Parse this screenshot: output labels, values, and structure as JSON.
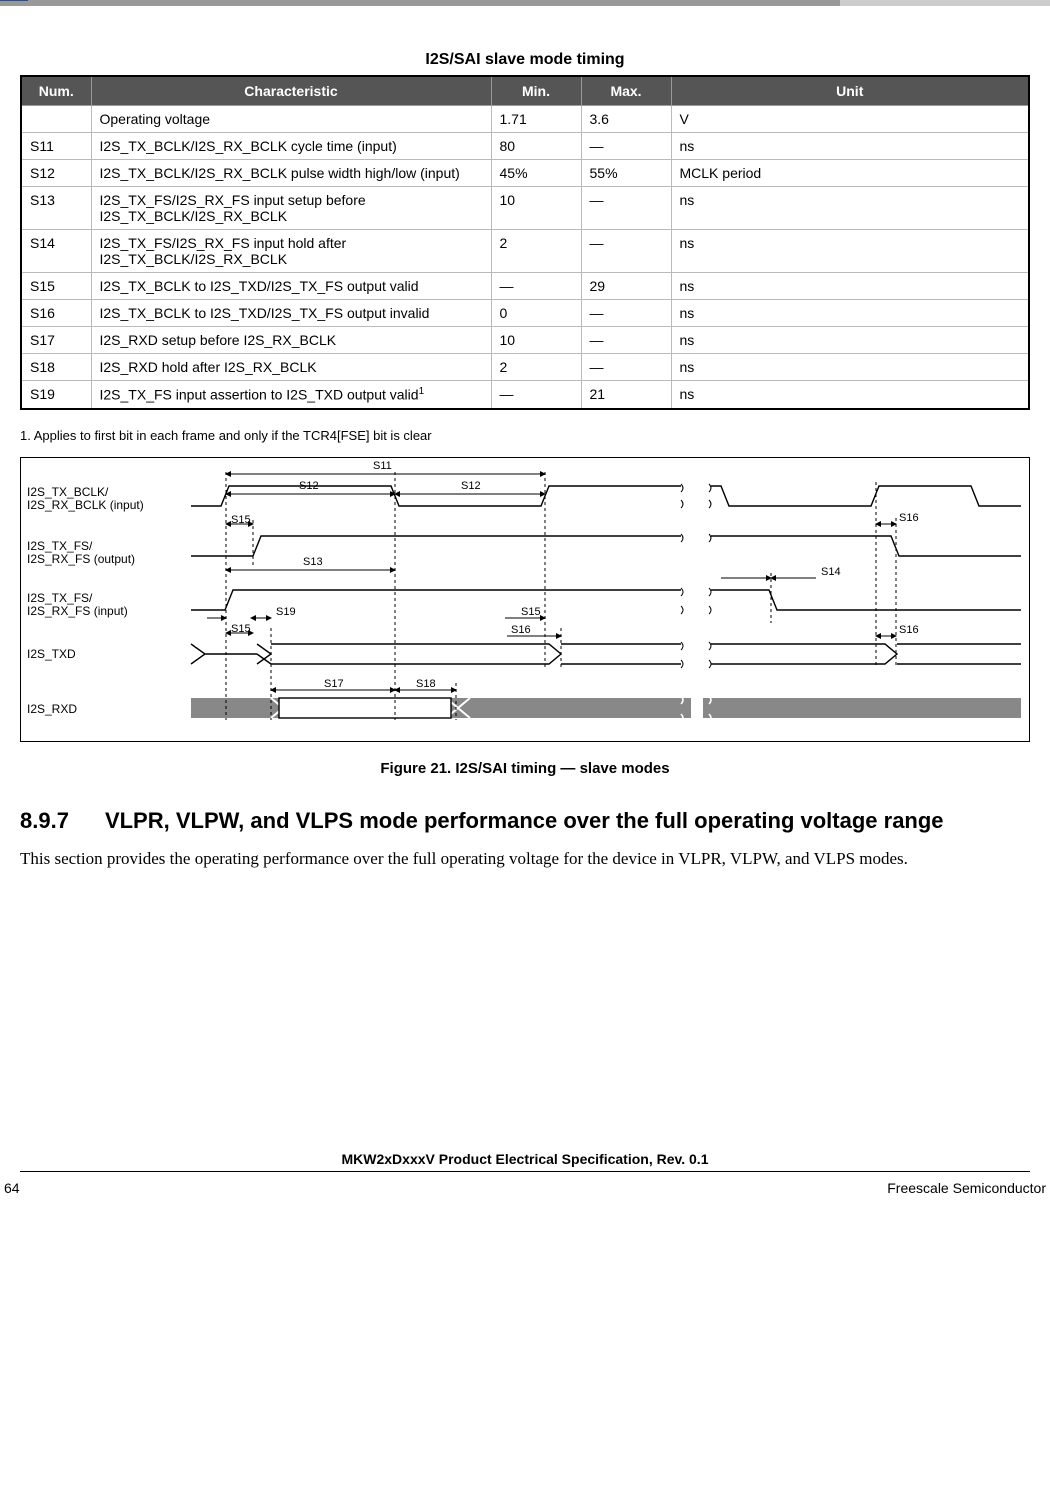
{
  "table_title": "I2S/SAI slave mode timing",
  "columns": {
    "num": "Num.",
    "char": "Characteristic",
    "min": "Min.",
    "max": "Max.",
    "unit": "Unit"
  },
  "rows": [
    {
      "num": "",
      "char": "Operating voltage",
      "min": "1.71",
      "max": "3.6",
      "unit": "V"
    },
    {
      "num": "S11",
      "char": "I2S_TX_BCLK/I2S_RX_BCLK cycle time (input)",
      "min": "80",
      "max": "—",
      "unit": "ns"
    },
    {
      "num": "S12",
      "char": "I2S_TX_BCLK/I2S_RX_BCLK pulse width high/low (input)",
      "min": "45%",
      "max": "55%",
      "unit": "MCLK period"
    },
    {
      "num": "S13",
      "char": "I2S_TX_FS/I2S_RX_FS input setup before I2S_TX_BCLK/I2S_RX_BCLK",
      "min": "10",
      "max": "—",
      "unit": "ns"
    },
    {
      "num": "S14",
      "char": "I2S_TX_FS/I2S_RX_FS input hold after I2S_TX_BCLK/I2S_RX_BCLK",
      "min": "2",
      "max": "—",
      "unit": "ns"
    },
    {
      "num": "S15",
      "char": "I2S_TX_BCLK to I2S_TXD/I2S_TX_FS output valid",
      "min": "—",
      "max": "29",
      "unit": "ns"
    },
    {
      "num": "S16",
      "char": "I2S_TX_BCLK to I2S_TXD/I2S_TX_FS output invalid",
      "min": "0",
      "max": "—",
      "unit": "ns"
    },
    {
      "num": "S17",
      "char": "I2S_RXD setup before I2S_RX_BCLK",
      "min": "10",
      "max": "—",
      "unit": "ns"
    },
    {
      "num": "S18",
      "char": "I2S_RXD hold after I2S_RX_BCLK",
      "min": "2",
      "max": "—",
      "unit": "ns"
    },
    {
      "num": "S19",
      "char": "I2S_TX_FS input assertion to I2S_TXD output valid",
      "min": "—",
      "max": "21",
      "unit": "ns",
      "sup": "1"
    }
  ],
  "footnote": "1.   Applies to first bit in each frame and only if the TCR4[FSE] bit is clear",
  "diagram": {
    "signals": [
      "I2S_TX_BCLK/\nI2S_RX_BCLK (input)",
      "I2S_TX_FS/\nI2S_RX_FS (output)",
      "I2S_TX_FS/\nI2S_RX_FS (input)",
      "I2S_TXD",
      "I2S_RXD"
    ],
    "markers": [
      "S11",
      "S12",
      "S12",
      "S13",
      "S14",
      "S15",
      "S15",
      "S15",
      "S16",
      "S16",
      "S16",
      "S17",
      "S18",
      "S19"
    ]
  },
  "figure_caption": "Figure 21. I2S/SAI timing — slave modes",
  "section": {
    "number": "8.9.7",
    "title": "VLPR, VLPW, and VLPS mode performance over the full operating voltage range",
    "body": "This section provides the operating performance over the full operating voltage for the device in VLPR, VLPW, and VLPS modes."
  },
  "footer": {
    "doc_title": "MKW2xDxxxV Product Electrical Specification, Rev. 0.1",
    "page_num": "64",
    "company": "Freescale Semiconductor"
  }
}
